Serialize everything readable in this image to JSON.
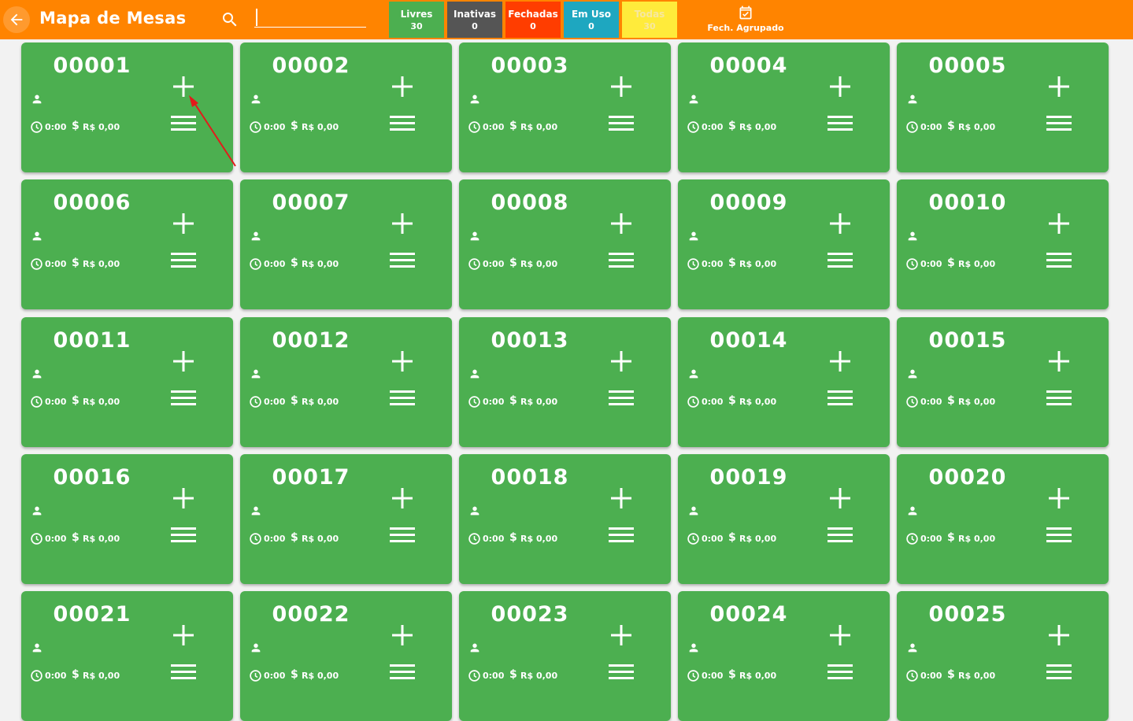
{
  "header": {
    "title": "Mapa de Mesas",
    "search_value": "",
    "fech_label": "Fech. Agrupado"
  },
  "filters": [
    {
      "label": "Livres",
      "count": "30",
      "color": "#4caf50"
    },
    {
      "label": "Inativas",
      "count": "0",
      "color": "#555555"
    },
    {
      "label": "Fechadas",
      "count": "0",
      "color": "#ff3d00"
    },
    {
      "label": "Em Uso",
      "count": "0",
      "color": "#1ea7c0"
    },
    {
      "label": "Todas",
      "count": "30",
      "color": "#ffeb3b"
    }
  ],
  "colors": {
    "accent": "#ff8400",
    "card": "#4caf50",
    "annotation": "#e21b1b"
  },
  "tables": [
    {
      "number": "00001",
      "time": "0:00",
      "price": "R$ 0,00"
    },
    {
      "number": "00002",
      "time": "0:00",
      "price": "R$ 0,00"
    },
    {
      "number": "00003",
      "time": "0:00",
      "price": "R$ 0,00"
    },
    {
      "number": "00004",
      "time": "0:00",
      "price": "R$ 0,00"
    },
    {
      "number": "00005",
      "time": "0:00",
      "price": "R$ 0,00"
    },
    {
      "number": "00006",
      "time": "0:00",
      "price": "R$ 0,00"
    },
    {
      "number": "00007",
      "time": "0:00",
      "price": "R$ 0,00"
    },
    {
      "number": "00008",
      "time": "0:00",
      "price": "R$ 0,00"
    },
    {
      "number": "00009",
      "time": "0:00",
      "price": "R$ 0,00"
    },
    {
      "number": "00010",
      "time": "0:00",
      "price": "R$ 0,00"
    },
    {
      "number": "00011",
      "time": "0:00",
      "price": "R$ 0,00"
    },
    {
      "number": "00012",
      "time": "0:00",
      "price": "R$ 0,00"
    },
    {
      "number": "00013",
      "time": "0:00",
      "price": "R$ 0,00"
    },
    {
      "number": "00014",
      "time": "0:00",
      "price": "R$ 0,00"
    },
    {
      "number": "00015",
      "time": "0:00",
      "price": "R$ 0,00"
    },
    {
      "number": "00016",
      "time": "0:00",
      "price": "R$ 0,00"
    },
    {
      "number": "00017",
      "time": "0:00",
      "price": "R$ 0,00"
    },
    {
      "number": "00018",
      "time": "0:00",
      "price": "R$ 0,00"
    },
    {
      "number": "00019",
      "time": "0:00",
      "price": "R$ 0,00"
    },
    {
      "number": "00020",
      "time": "0:00",
      "price": "R$ 0,00"
    },
    {
      "number": "00021",
      "time": "0:00",
      "price": "R$ 0,00"
    },
    {
      "number": "00022",
      "time": "0:00",
      "price": "R$ 0,00"
    },
    {
      "number": "00023",
      "time": "0:00",
      "price": "R$ 0,00"
    },
    {
      "number": "00024",
      "time": "0:00",
      "price": "R$ 0,00"
    },
    {
      "number": "00025",
      "time": "0:00",
      "price": "R$ 0,00"
    }
  ]
}
